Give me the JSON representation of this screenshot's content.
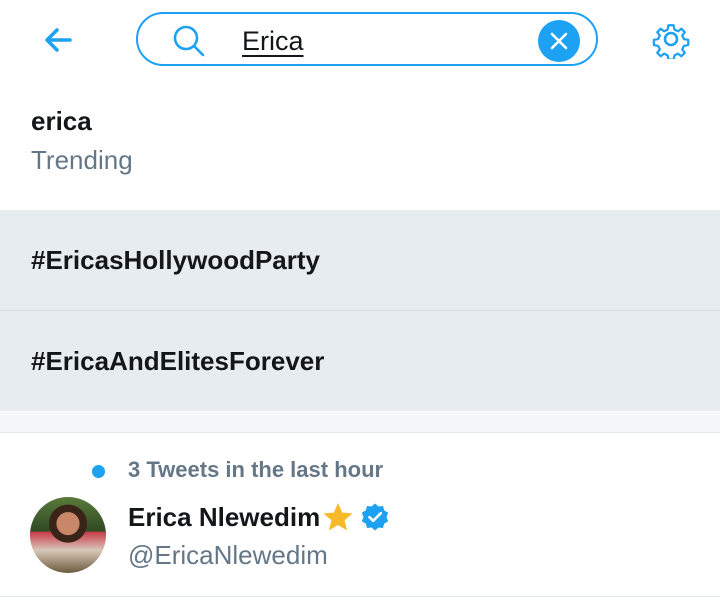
{
  "header": {
    "back_icon": "arrow-left-icon",
    "search_value": "Erica",
    "search_icon": "search-icon",
    "clear_icon": "close-icon",
    "settings_icon": "gear-icon",
    "accent_color": "#1da1f2"
  },
  "suggestions": [
    {
      "title": "erica",
      "subtitle": "Trending"
    },
    {
      "title": "#EricasHollywoodParty"
    },
    {
      "title": "#EricaAndElitesForever"
    }
  ],
  "account": {
    "activity": "3 Tweets in the last hour",
    "name": "Erica Nlewedim",
    "emoji": "star-emoji",
    "verified": true,
    "handle": "@EricaNlewedim"
  }
}
